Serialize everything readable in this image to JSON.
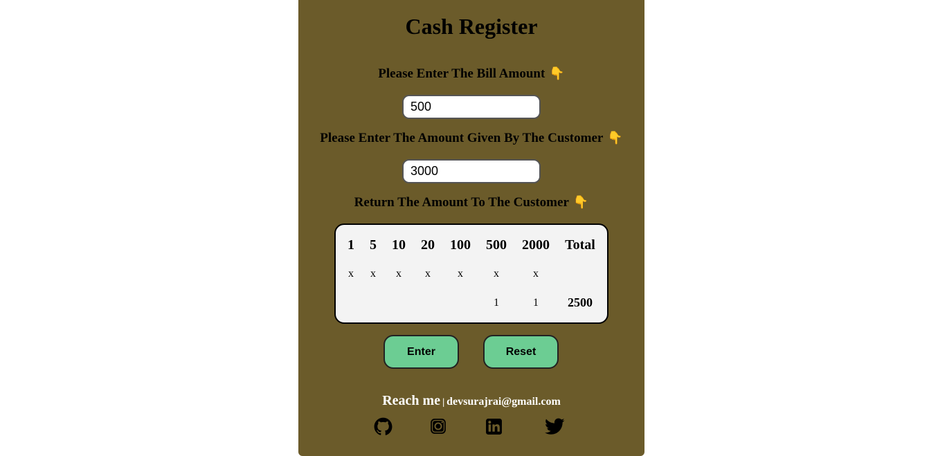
{
  "app": {
    "title": "Cash Register"
  },
  "bill": {
    "label": "Please Enter The Bill Amount",
    "emoji": "👇",
    "value": "500"
  },
  "cash": {
    "label": "Please Enter The Amount Given By The Customer",
    "emoji": "👇",
    "value": "3000"
  },
  "return": {
    "label": "Return The Amount To The Customer",
    "emoji": "👇"
  },
  "table": {
    "headers": [
      "1",
      "5",
      "10",
      "20",
      "100",
      "500",
      "2000",
      "Total"
    ],
    "multipliers": [
      "x",
      "x",
      "x",
      "x",
      "x",
      "x",
      "x"
    ],
    "counts": [
      "",
      "",
      "",
      "",
      "",
      "1",
      "1"
    ],
    "total": "2500"
  },
  "buttons": {
    "enter": "Enter",
    "reset": "Reset"
  },
  "footer": {
    "reach_label": "Reach me",
    "separator": "|",
    "email": "devsurajrai@gmail.com",
    "social_icons": [
      "github-icon",
      "instagram-icon",
      "linkedin-icon",
      "twitter-icon"
    ]
  },
  "colors": {
    "panel_bg": "#6b5b2a",
    "button_bg": "#6ccd93",
    "table_bg": "#f3f3f3"
  }
}
